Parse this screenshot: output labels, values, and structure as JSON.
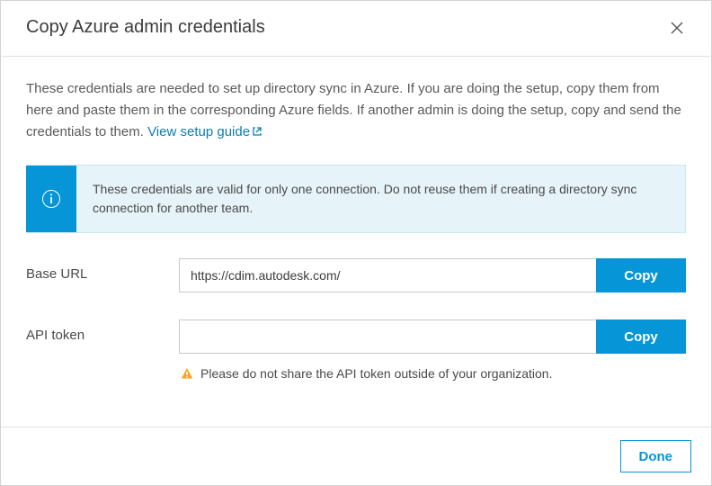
{
  "dialog": {
    "title": "Copy Azure admin credentials",
    "intro": "These credentials are needed to set up directory sync in Azure. If you are doing the setup, copy them from here and paste them in the corresponding Azure fields. If another admin is doing the setup, copy and send the credentials to them. ",
    "setup_link_label": "View setup guide",
    "info_banner": "These credentials are valid for only one connection. Do not reuse them if creating a directory sync connection for another team.",
    "fields": {
      "base_url": {
        "label": "Base URL",
        "value": "https://cdim.autodesk.com/",
        "copy_label": "Copy"
      },
      "api_token": {
        "label": "API token",
        "value": "",
        "copy_label": "Copy",
        "warning": "Please do not share the API token outside of your organization."
      }
    },
    "done_label": "Done"
  },
  "colors": {
    "accent": "#0696d7",
    "link": "#0e7db2",
    "warning": "#faa21b"
  }
}
